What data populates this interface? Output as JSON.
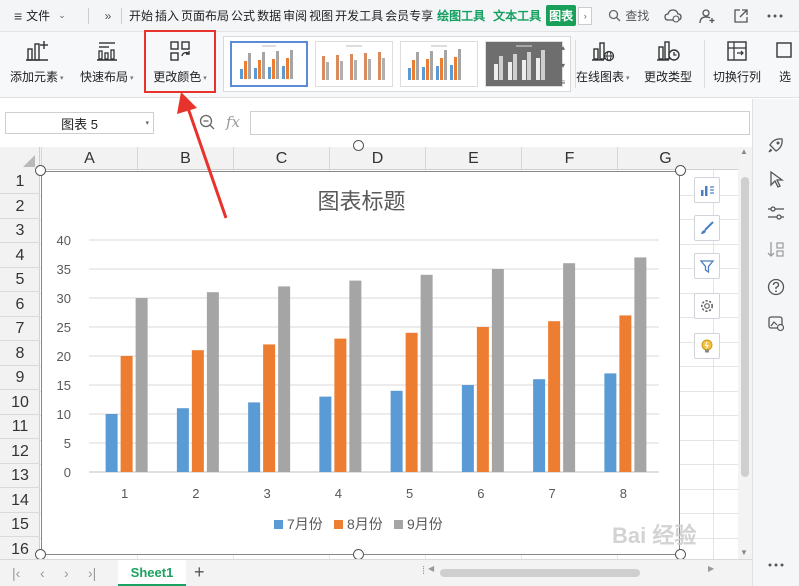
{
  "menubar": {
    "file_label": "文件",
    "tabs": [
      "开始",
      "插入",
      "页面布局",
      "公式",
      "数据",
      "审阅",
      "视图",
      "开发工具",
      "会员专享"
    ],
    "context_tabs": [
      "绘图工具",
      "文本工具"
    ],
    "active_context_tab": "图表",
    "search_label": "查找"
  },
  "ribbon": {
    "add_element": "添加元素",
    "quick_layout": "快速布局",
    "change_color": "更改颜色",
    "online_chart": "在线图表",
    "change_type": "更改类型",
    "switch_row_col": "切换行列",
    "truncated": "选"
  },
  "formula_bar": {
    "name_box": "图表 5",
    "fx": "fx",
    "formula": ""
  },
  "grid": {
    "columns": [
      "A",
      "B",
      "C",
      "D",
      "E",
      "F",
      "G"
    ],
    "rows": [
      "1",
      "2",
      "3",
      "4",
      "5",
      "6",
      "7",
      "8",
      "9",
      "10",
      "11",
      "12",
      "13",
      "14",
      "15",
      "16"
    ]
  },
  "chart_data": {
    "type": "bar",
    "title": "图表标题",
    "categories": [
      "1",
      "2",
      "3",
      "4",
      "5",
      "6",
      "7",
      "8"
    ],
    "series": [
      {
        "name": "7月份",
        "color": "#5b9bd5",
        "values": [
          10,
          11,
          12,
          13,
          14,
          15,
          16,
          17
        ]
      },
      {
        "name": "8月份",
        "color": "#ed7d31",
        "values": [
          20,
          21,
          22,
          23,
          24,
          25,
          26,
          27
        ]
      },
      {
        "name": "9月份",
        "color": "#a5a5a5",
        "values": [
          30,
          31,
          32,
          33,
          34,
          35,
          36,
          37
        ]
      }
    ],
    "ylim": [
      0,
      40
    ],
    "yticks": [
      0,
      5,
      10,
      15,
      20,
      25,
      30,
      35,
      40
    ],
    "grid": true,
    "legend": "bottom"
  },
  "sheets": {
    "active": "Sheet1"
  },
  "watermark": "Bai 经验",
  "colors": {
    "accent_green": "#18a058",
    "highlight_red": "#e8322c"
  }
}
